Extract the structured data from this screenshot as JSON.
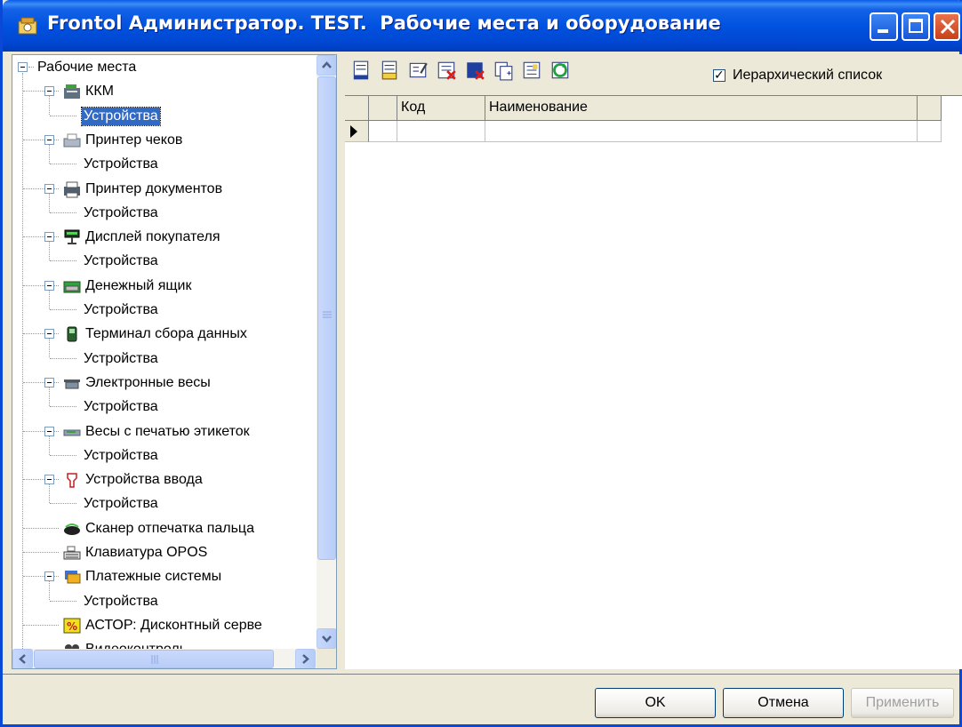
{
  "window": {
    "title": "Frontol Администратор. TEST.  Рабочие места и оборудование",
    "accent_color": "#0054e3"
  },
  "tree": {
    "root_label": "Рабочие места",
    "items": [
      {
        "label": "ККМ",
        "icon": "cash-register-icon",
        "level": 1
      },
      {
        "label": "Устройства",
        "icon": "",
        "level": 2,
        "selected": true
      },
      {
        "label": "Принтер чеков",
        "icon": "receipt-printer-icon",
        "level": 1
      },
      {
        "label": "Устройства",
        "icon": "",
        "level": 2
      },
      {
        "label": "Принтер документов",
        "icon": "document-printer-icon",
        "level": 1
      },
      {
        "label": "Устройства",
        "icon": "",
        "level": 2
      },
      {
        "label": "Дисплей покупателя",
        "icon": "customer-display-icon",
        "level": 1
      },
      {
        "label": "Устройства",
        "icon": "",
        "level": 2
      },
      {
        "label": "Денежный ящик",
        "icon": "cash-drawer-icon",
        "level": 1
      },
      {
        "label": "Устройства",
        "icon": "",
        "level": 2
      },
      {
        "label": "Терминал сбора данных",
        "icon": "data-terminal-icon",
        "level": 1
      },
      {
        "label": "Устройства",
        "icon": "",
        "level": 2
      },
      {
        "label": "Электронные весы",
        "icon": "scales-icon",
        "level": 1
      },
      {
        "label": "Устройства",
        "icon": "",
        "level": 2
      },
      {
        "label": "Весы с печатью этикеток",
        "icon": "label-scales-icon",
        "level": 1
      },
      {
        "label": "Устройства",
        "icon": "",
        "level": 2
      },
      {
        "label": "Устройства ввода",
        "icon": "input-device-icon",
        "level": 1
      },
      {
        "label": "Устройства",
        "icon": "",
        "level": 2
      },
      {
        "label": "Сканер отпечатка пальца",
        "icon": "fingerprint-scanner-icon",
        "level": 1
      },
      {
        "label": "Клавиатура OPOS",
        "icon": "keyboard-icon",
        "level": 1
      },
      {
        "label": "Платежные системы",
        "icon": "payment-system-icon",
        "level": 1
      },
      {
        "label": "Устройства",
        "icon": "",
        "level": 2
      },
      {
        "label": "АСТОР: Дисконтный серве",
        "icon": "discount-server-icon",
        "level": 1
      },
      {
        "label": "Видеоконтроль",
        "icon": "video-control-icon",
        "level": 1
      }
    ]
  },
  "toolbar": {
    "buttons": [
      {
        "name": "add-item-button",
        "icon": "add-item-icon"
      },
      {
        "name": "add-group-button",
        "icon": "add-group-icon"
      },
      {
        "name": "edit-button",
        "icon": "edit-icon"
      },
      {
        "name": "delete-button",
        "icon": "delete-icon"
      },
      {
        "name": "delete-group-button",
        "icon": "delete-group-icon"
      },
      {
        "name": "copy-button",
        "icon": "copy-icon"
      },
      {
        "name": "properties-button",
        "icon": "properties-icon"
      },
      {
        "name": "refresh-button",
        "icon": "refresh-icon"
      }
    ],
    "hierarchical_label": "Иерархический список",
    "hierarchical_checked": true
  },
  "grid": {
    "columns": [
      "",
      "Код",
      "Наименование"
    ]
  },
  "footer": {
    "ok_label": "OK",
    "cancel_label": "Отмена",
    "apply_label": "Применить"
  }
}
